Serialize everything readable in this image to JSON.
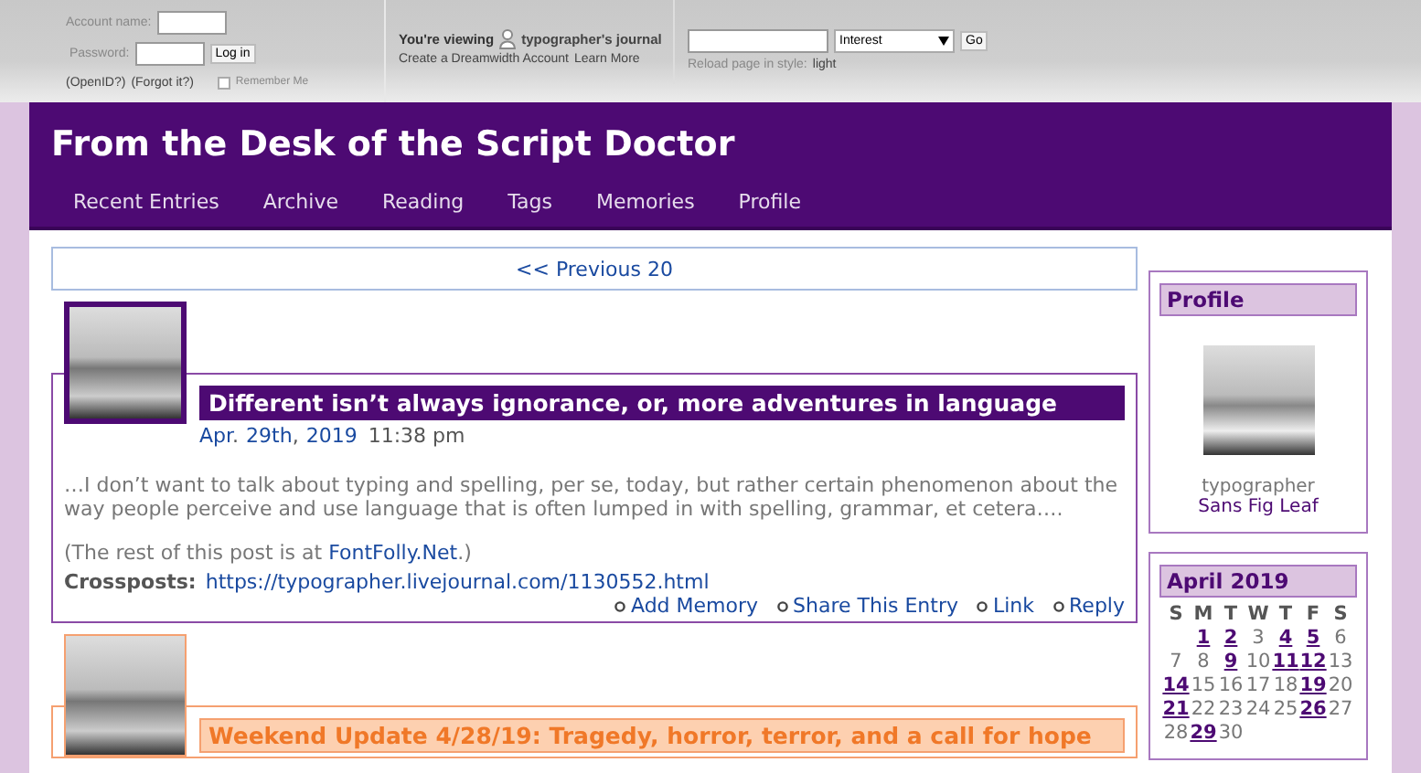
{
  "login": {
    "account_label": "Account name:",
    "password_label": "Password:",
    "login_button": "Log in",
    "openid_link": "(OpenID?)",
    "forgot_link": "(Forgot it?)",
    "remember_label": "Remember Me",
    "remember_checked": false
  },
  "viewing": {
    "prefix": "You're viewing",
    "journal": "typographer's journal",
    "create_link": "Create a Dreamwidth Account",
    "learn_link": "Learn More"
  },
  "search": {
    "select_value": "Interest",
    "go_button": "Go",
    "reload_label": "Reload page in style:",
    "style_link": "light"
  },
  "header": {
    "title": "From the Desk of the Script Doctor",
    "nav": [
      "Recent Entries",
      "Archive",
      "Reading",
      "Tags",
      "Memories",
      "Profile"
    ]
  },
  "pager": {
    "link": "<< Previous 20"
  },
  "entries": [
    {
      "highlighted": false,
      "title": "Different isn’t always ignorance, or, more adventures in language",
      "date": {
        "month": "Apr",
        "sep1": ".",
        "day": "29th",
        "sep2": ",",
        "year": "2019",
        "time": "11:38 pm"
      },
      "body": "…I don’t want to talk about typing and spelling, per se, today, but rather certain phenomenon about the way people perceive and use language that is often lumped in with spelling, grammar, et cetera….",
      "rest_prefix": "(The rest of this post is at ",
      "rest_link": "FontFolly.Net",
      "rest_suffix": ".)",
      "crossposts_label": "Crossposts:",
      "crossposts_link": "https://typographer.livejournal.com/1130552.html",
      "actions": [
        "Add Memory",
        "Share This Entry",
        "Link",
        "Reply"
      ]
    },
    {
      "highlighted": true,
      "title": "Weekend Update 4/28/19: Tragedy, horror, terror, and a call for hope"
    }
  ],
  "sidebar": {
    "profile": {
      "heading": "Profile",
      "username": "typographer",
      "name_link": "Sans Fig Leaf"
    },
    "calendar": {
      "heading": "April 2019",
      "weekdays": [
        "S",
        "M",
        "T",
        "W",
        "T",
        "F",
        "S"
      ],
      "weeks": [
        [
          {
            "day": "1",
            "linked": true
          },
          {
            "day": "2",
            "linked": true
          },
          {
            "day": "3",
            "linked": false
          },
          {
            "day": "4",
            "linked": true
          },
          {
            "day": "5",
            "linked": true
          },
          {
            "day": "6",
            "linked": false
          }
        ],
        [
          {
            "day": "7",
            "linked": false
          },
          {
            "day": "8",
            "linked": false
          },
          {
            "day": "9",
            "linked": true
          },
          {
            "day": "10",
            "linked": false
          },
          {
            "day": "11",
            "linked": true
          },
          {
            "day": "12",
            "linked": true
          },
          {
            "day": "13",
            "linked": false
          }
        ],
        [
          {
            "day": "14",
            "linked": true
          },
          {
            "day": "15",
            "linked": false
          },
          {
            "day": "16",
            "linked": false
          },
          {
            "day": "17",
            "linked": false
          },
          {
            "day": "18",
            "linked": false
          },
          {
            "day": "19",
            "linked": true
          },
          {
            "day": "20",
            "linked": false
          }
        ],
        [
          {
            "day": "21",
            "linked": true
          },
          {
            "day": "22",
            "linked": false
          },
          {
            "day": "23",
            "linked": false
          },
          {
            "day": "24",
            "linked": false
          },
          {
            "day": "25",
            "linked": false
          },
          {
            "day": "26",
            "linked": true
          },
          {
            "day": "27",
            "linked": false
          }
        ],
        [
          {
            "day": "28",
            "linked": false
          },
          {
            "day": "29",
            "linked": true
          },
          {
            "day": "30",
            "linked": false
          }
        ]
      ]
    }
  }
}
